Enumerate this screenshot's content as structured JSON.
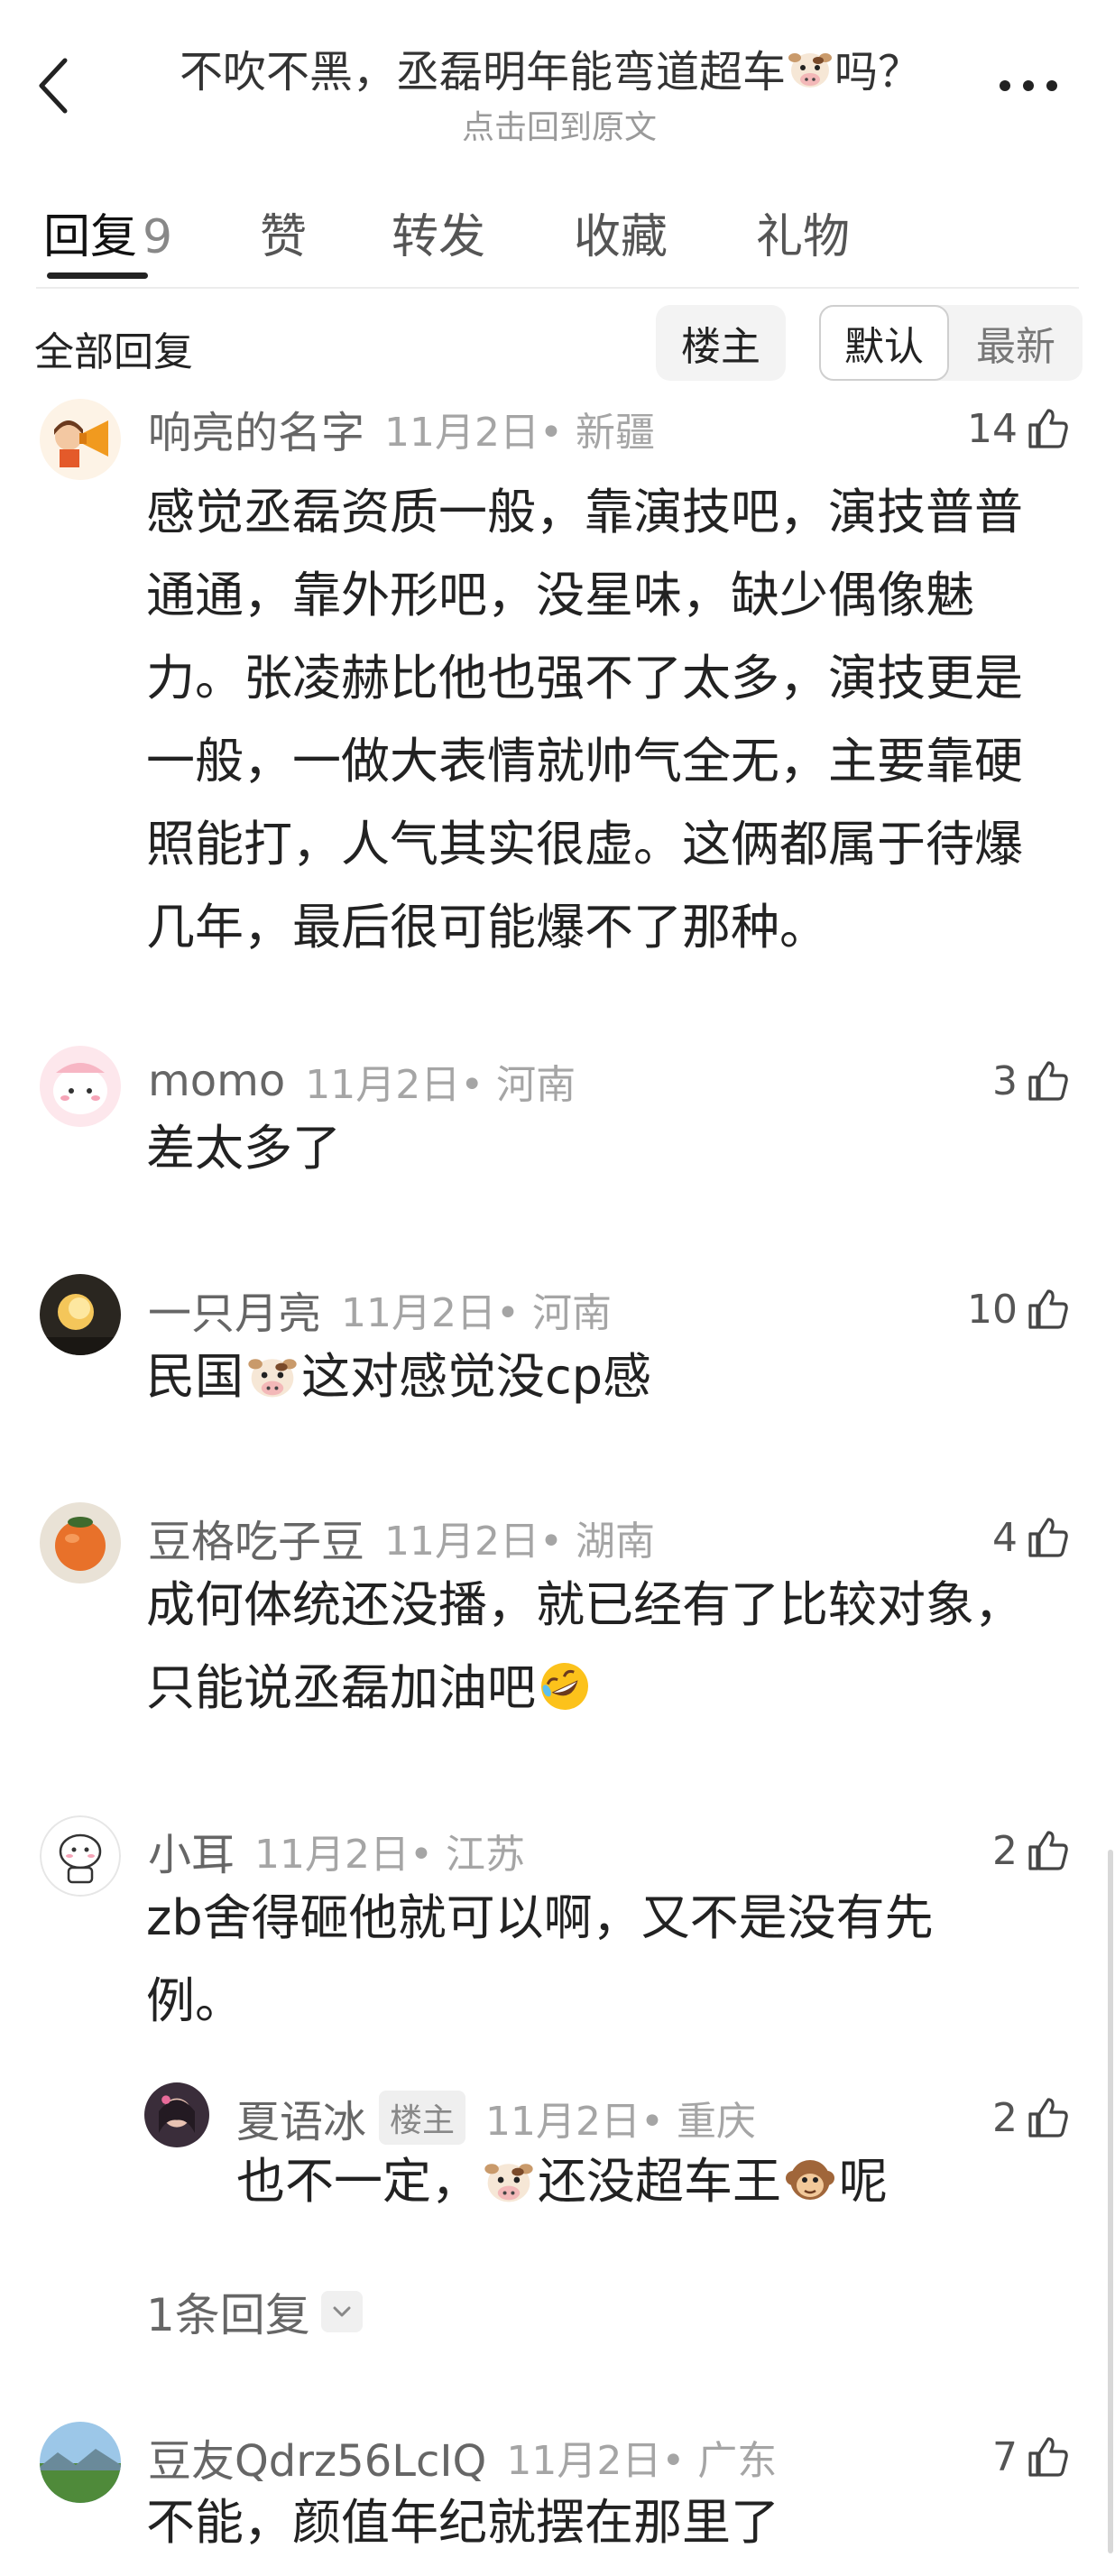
{
  "header": {
    "title_before": "不吹不黑，丞磊明年能弯道超车",
    "title_after": "吗？",
    "subtitle": "点击回到原文"
  },
  "tabs": [
    {
      "label": "回复",
      "count": "9"
    },
    {
      "label": "赞"
    },
    {
      "label": "转发"
    },
    {
      "label": "收藏"
    },
    {
      "label": "礼物"
    }
  ],
  "filter": {
    "label": "全部回复",
    "op_only": "楼主",
    "sort_default": "默认",
    "sort_latest": "最新"
  },
  "comments": [
    {
      "user": "响亮的名字",
      "time": "11月2日",
      "location": "• 新疆",
      "likes": "14",
      "lines": [
        "感觉丞磊资质一般，靠演技吧，演技普普",
        "通通，靠外形吧，没星味，缺少偶像魅",
        "力。张凌赫比他也强不了太多，演技更是",
        "一般，一做大表情就帅气全无，主要靠硬",
        "照能打，人气其实很虚。这俩都属于待爆",
        "几年，最后很可能爆不了那种。"
      ]
    },
    {
      "user": "momo",
      "time": "11月2日",
      "location": "• 河南",
      "likes": "3",
      "text": "差太多了"
    },
    {
      "user": "一只月亮",
      "time": "11月2日",
      "location": "• 河南",
      "likes": "10",
      "text_before": "民国",
      "text_after": "这对感觉没cp感"
    },
    {
      "user": "豆格吃子豆",
      "time": "11月2日",
      "location": "• 湖南",
      "likes": "4",
      "line1": "成何体统还没播，就已经有了比较对象，",
      "line2": "只能说丞磊加油吧"
    },
    {
      "user": "小耳",
      "time": "11月2日",
      "location": "• 江苏",
      "likes": "2",
      "lines": [
        "zb舍得砸他就可以啊，又不是没有先",
        "例。"
      ],
      "reply": {
        "user": "夏语冰",
        "badge": "楼主",
        "time": "11月2日",
        "location": "• 重庆",
        "likes": "2",
        "text_1": "也不一定，",
        "text_2": "还没超车王",
        "text_3": "呢"
      },
      "more_replies": "1条回复"
    },
    {
      "user": "豆友Qdrz56LcIQ",
      "time": "11月2日",
      "location": "• 广东",
      "likes": "7",
      "text": "不能，颜值年纪就摆在那里了"
    }
  ],
  "icons": {
    "back": "chevron-left-icon",
    "more": "more-dots-icon",
    "like": "thumbs-up-icon",
    "expand": "chevron-down-icon",
    "emoji_cow": "cow-emoji-icon",
    "emoji_laugh": "rofl-emoji-icon",
    "emoji_monkey": "monkey-emoji-icon"
  }
}
